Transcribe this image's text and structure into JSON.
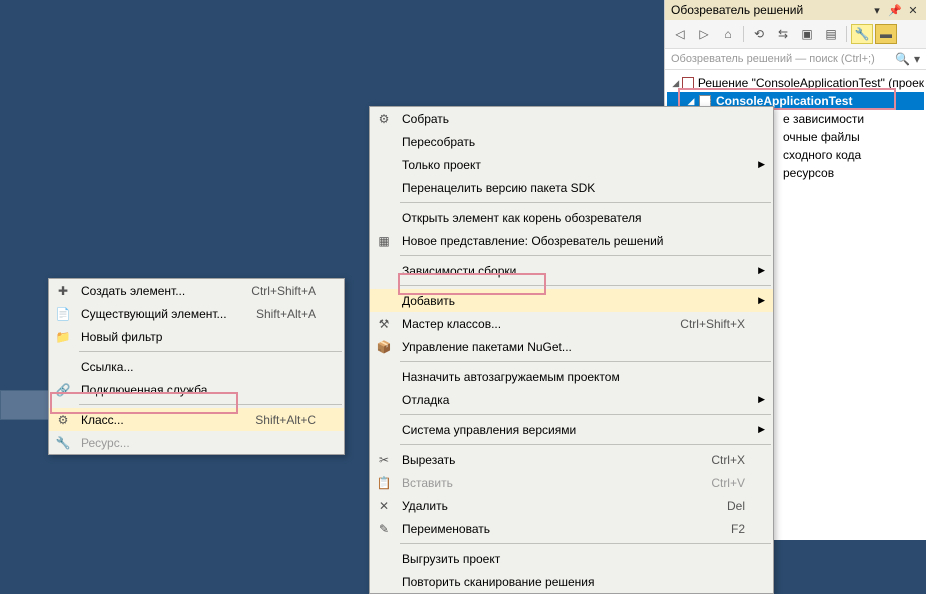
{
  "solutionExplorer": {
    "title": "Обозреватель решений",
    "searchPlaceholder": "Обозреватель решений — поиск (Ctrl+;)",
    "solutionLabel": "Решение \"ConsoleApplicationTest\" (проек",
    "projectLabel": "ConsoleApplicationTest",
    "nodes": {
      "deps": "е зависимости",
      "sources": "очные файлы",
      "srccode": "сходного кода",
      "resources": "ресурсов"
    }
  },
  "mainMenu": {
    "build": "Собрать",
    "rebuild": "Пересобрать",
    "projectOnly": "Только проект",
    "retargetSdk": "Перенацелить версию пакета SDK",
    "openAsRoot": "Открыть элемент как корень обозревателя",
    "newView": "Новое представление: Обозреватель решений",
    "buildDeps": "Зависимости сборки",
    "add": "Добавить",
    "classWizard": "Мастер классов...",
    "classWizardShortcut": "Ctrl+Shift+X",
    "nuget": "Управление пакетами NuGet...",
    "setStartup": "Назначить автозагружаемым проектом",
    "debug": "Отладка",
    "sourceControl": "Система управления версиями",
    "cut": "Вырезать",
    "cutShortcut": "Ctrl+X",
    "paste": "Вставить",
    "pasteShortcut": "Ctrl+V",
    "delete": "Удалить",
    "deleteShortcut": "Del",
    "rename": "Переименовать",
    "renameShortcut": "F2",
    "unload": "Выгрузить проект",
    "rescan": "Повторить сканирование решения"
  },
  "subMenu": {
    "newItem": "Создать элемент...",
    "newItemShortcut": "Ctrl+Shift+A",
    "existingItem": "Существующий элемент...",
    "existingItemShortcut": "Shift+Alt+A",
    "newFilter": "Новый фильтр",
    "reference": "Ссылка...",
    "connectedService": "Подключенная служба...",
    "class": "Класс...",
    "classShortcut": "Shift+Alt+C",
    "resource": "Ресурс..."
  }
}
